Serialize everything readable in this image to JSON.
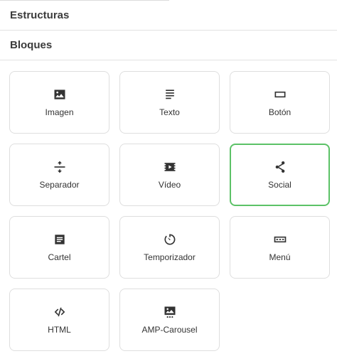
{
  "sections": {
    "estructuras": "Estructuras",
    "bloques": "Bloques"
  },
  "blocks": [
    {
      "label": "Imagen",
      "icon": "image-icon"
    },
    {
      "label": "Texto",
      "icon": "text-icon"
    },
    {
      "label": "Botón",
      "icon": "button-icon"
    },
    {
      "label": "Separador",
      "icon": "separator-icon"
    },
    {
      "label": "Vídeo",
      "icon": "video-icon"
    },
    {
      "label": "Social",
      "icon": "share-icon",
      "selected": true
    },
    {
      "label": "Cartel",
      "icon": "banner-icon"
    },
    {
      "label": "Temporizador",
      "icon": "timer-icon"
    },
    {
      "label": "Menú",
      "icon": "menu-icon"
    },
    {
      "label": "HTML",
      "icon": "code-icon"
    },
    {
      "label": "AMP-Carousel",
      "icon": "carousel-icon"
    }
  ],
  "colors": {
    "selected_border": "#5cc267",
    "tile_border": "#dedede",
    "text": "#333333"
  }
}
